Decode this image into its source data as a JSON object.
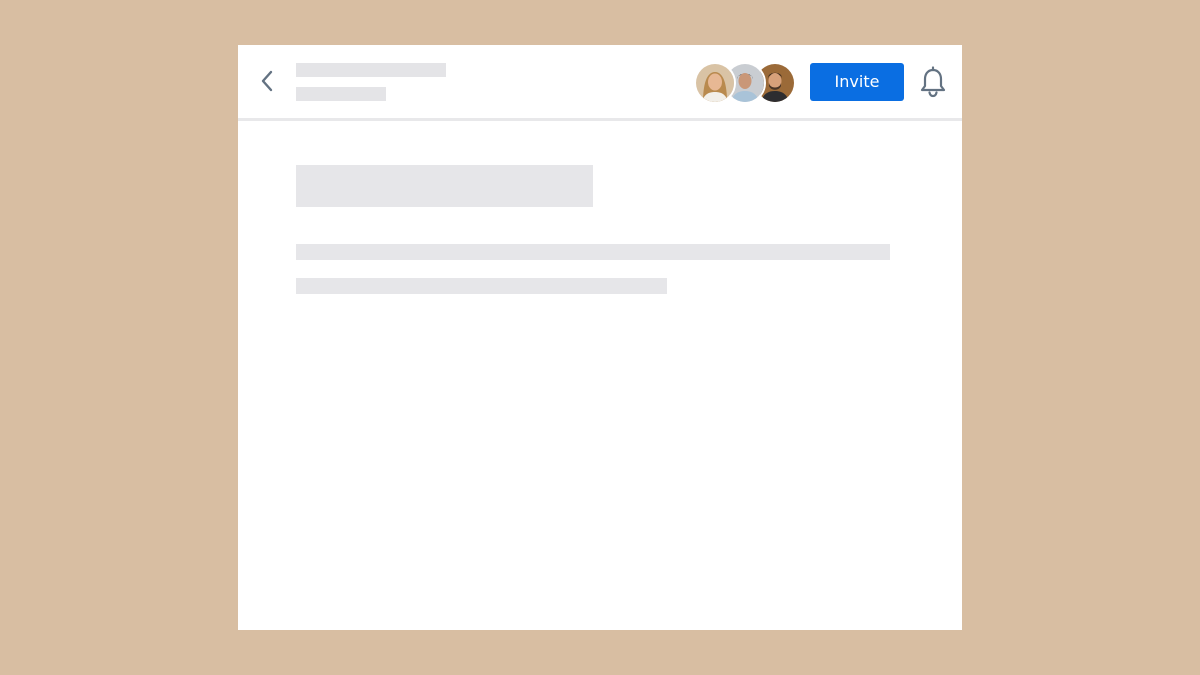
{
  "header": {
    "invite_label": "Invite"
  },
  "icons": {
    "back": "chevron-left-icon",
    "notifications": "bell-icon"
  },
  "colors": {
    "background": "#d8bea2",
    "accent": "#0a6ee2",
    "skeleton": "#e6e6e9"
  }
}
